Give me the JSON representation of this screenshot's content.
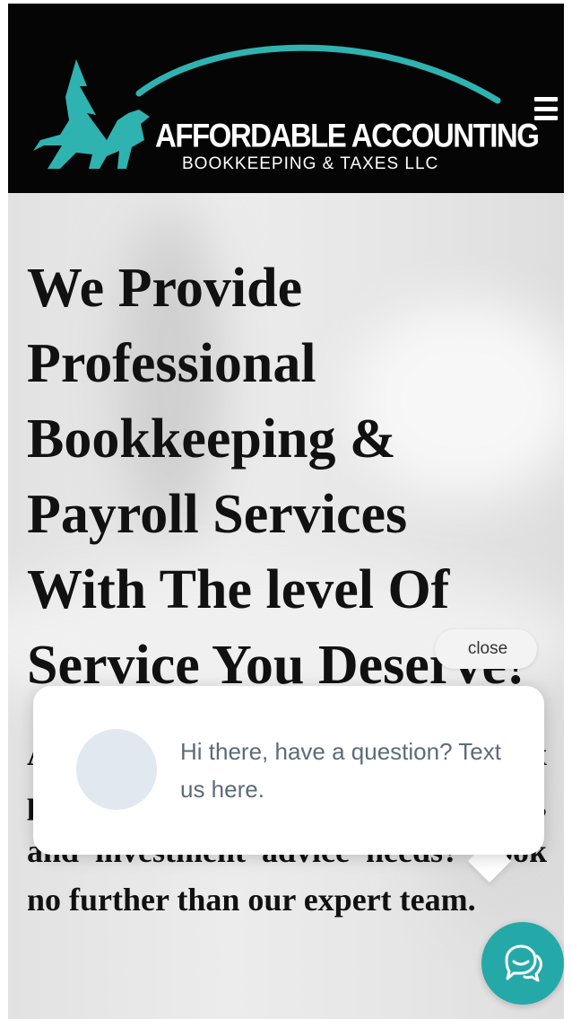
{
  "header": {
    "logo_title": "AFFORDABLE ACCOUNTING",
    "logo_subtitle": "BOOKKEEPING & TAXES LLC",
    "menu_icon": "hamburger-icon"
  },
  "hero": {
    "title_lines": [
      "We Provide",
      "Professional",
      "Bookkeeping &",
      "Payroll Services",
      "With The level Of",
      "Service You Deserve!"
    ],
    "text": "Are you looking for help to with tax preparation, bookkeeping, payroll, and investment advice needs? Look no further than our expert team."
  },
  "chat": {
    "close_label": "close",
    "message": "Hi there, have a question? Text us here.",
    "button_icon": "chat-bubble-icon",
    "accent": "#25a9a8"
  },
  "colors": {
    "header_bg": "#050505",
    "logo_teal": "#2fb3b0"
  }
}
